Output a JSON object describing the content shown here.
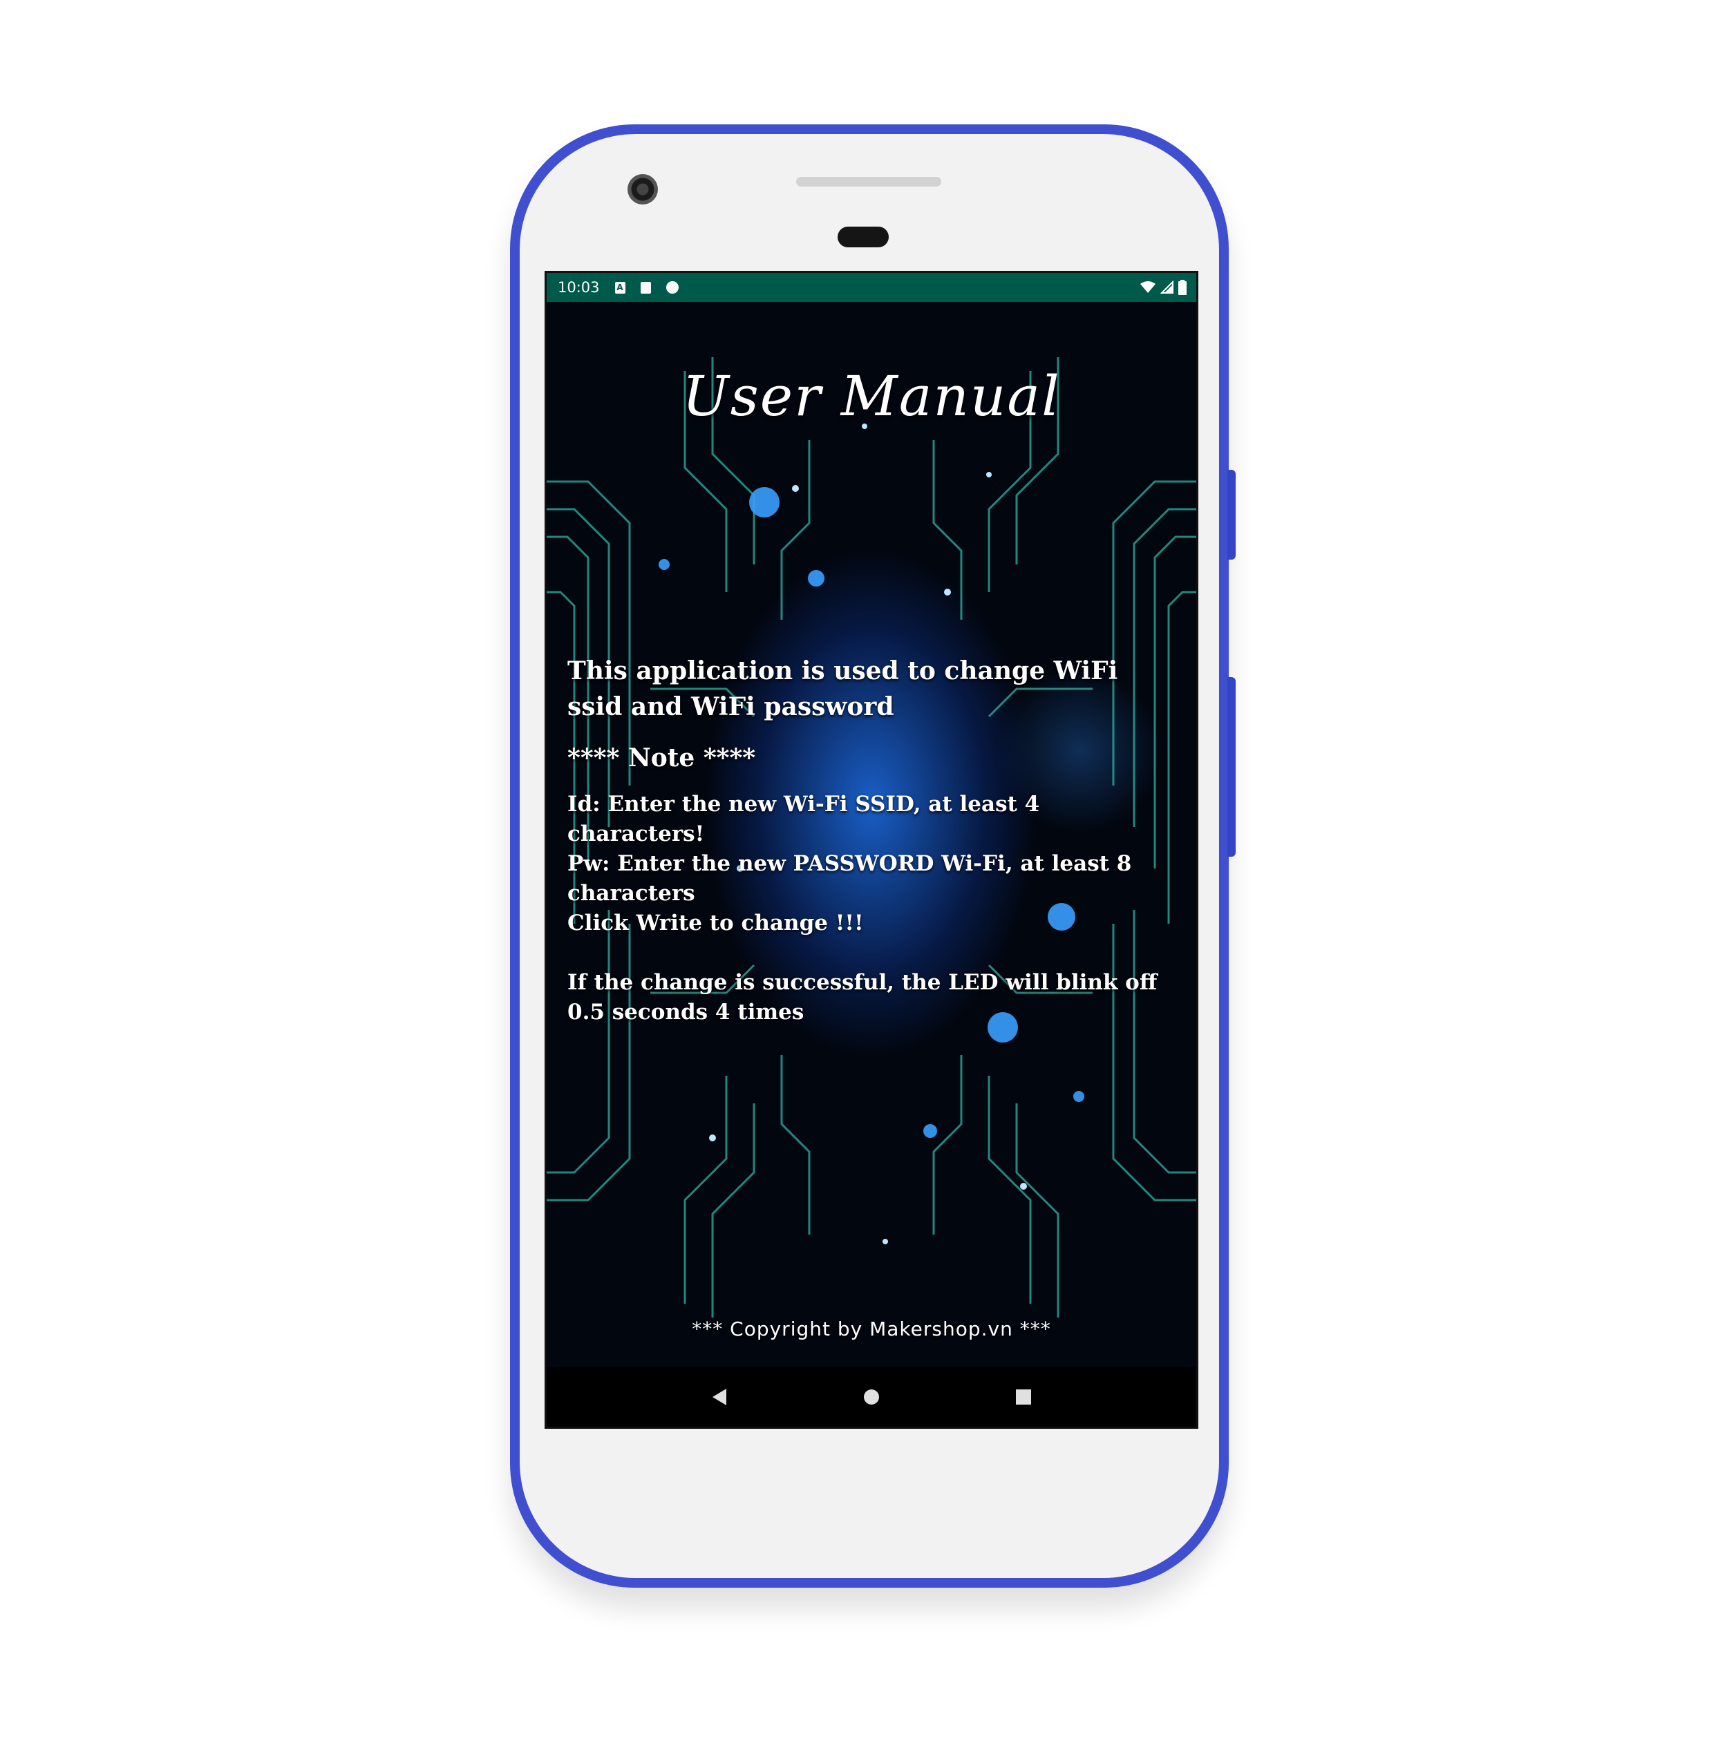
{
  "status_bar": {
    "time": "10:03",
    "left_icons": [
      "A",
      "sd-card",
      "sync"
    ],
    "right_icons": [
      "wifi-icon",
      "signal-icon",
      "battery-icon"
    ]
  },
  "screen": {
    "title": "User Manual",
    "intro": "This application is used to change WiFi ssid and WiFi password",
    "note_heading": "**** Note ****",
    "instructions": {
      "id_line": "Id: Enter the new Wi-Fi SSID, at least 4 characters!",
      "pw_line": "Pw: Enter the new PASSWORD Wi-Fi, at least 8 characters",
      "click_line": "Click Write to change !!!",
      "success_line": "If the change is successful, the LED will blink off 0.5 seconds 4 times"
    },
    "copyright": "*** Copyright by Makershop.vn ***"
  },
  "nav_bar": {
    "buttons": [
      "back-icon",
      "home-icon",
      "recents-icon"
    ]
  },
  "colors": {
    "phone_frame": "#3f4fd0",
    "status_bar": "#005a4b",
    "circuit_teal": "#2fb3a3",
    "circuit_blue": "#3aa0ff",
    "text": "#ffffff"
  }
}
